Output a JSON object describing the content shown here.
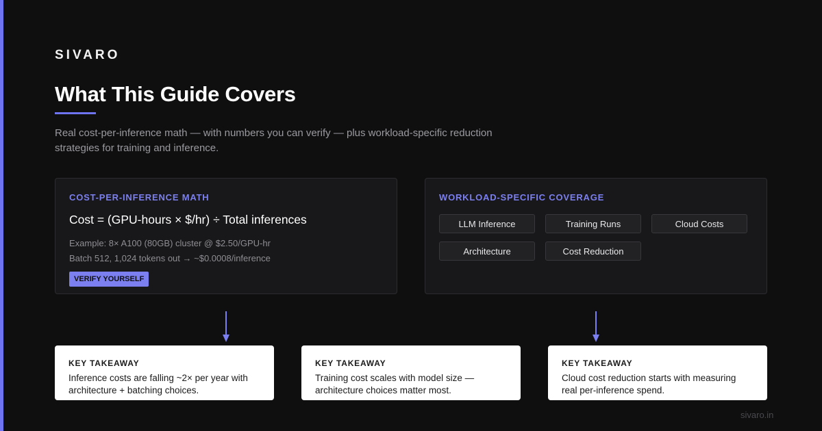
{
  "brand": "SIVARO",
  "title": "What This Guide Covers",
  "subtitle": "Real cost-per-inference math — with numbers you can verify — plus workload-specific reduction strategies for training and inference.",
  "math_card": {
    "heading": "COST-PER-INFERENCE MATH",
    "formula": "Cost = (GPU-hours × $/hr) ÷ Total inferences",
    "example_line1": "Example: 8× A100 (80GB) cluster @ $2.50/GPU-hr",
    "example_line2": "Batch 512, 1,024 tokens out → ~$0.0008/inference",
    "badge": "VERIFY YOURSELF"
  },
  "coverage_card": {
    "heading": "WORKLOAD-SPECIFIC COVERAGE",
    "chips": [
      "LLM Inference",
      "Training Runs",
      "Cloud Costs",
      "Architecture",
      "Cost Reduction"
    ]
  },
  "takeaways": [
    {
      "label": "KEY TAKEAWAY",
      "text": "Inference costs are falling ~2× per year with architecture + batching choices."
    },
    {
      "label": "KEY TAKEAWAY",
      "text": "Training cost scales with model size — architecture choices matter most."
    },
    {
      "label": "KEY TAKEAWAY",
      "text": "Cloud cost reduction starts with measuring real per-inference spend."
    }
  ],
  "footer": "sivaro.in",
  "colors": {
    "accent": "#6f74f2",
    "heading_accent": "#7b7ff0",
    "background": "#0f0f10",
    "card": "#18181a",
    "takeaway_bg": "#ffffff"
  }
}
